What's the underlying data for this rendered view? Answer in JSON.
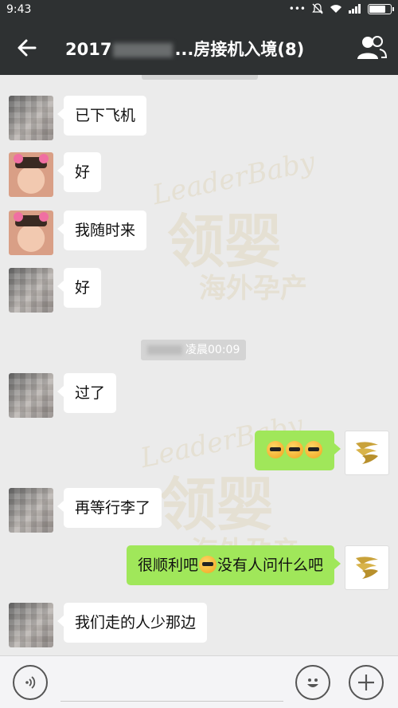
{
  "status": {
    "time": "9:43",
    "dots": "•••"
  },
  "header": {
    "title_prefix": "2017",
    "title_suffix": "...房接机入境(8)"
  },
  "chat": {
    "watermark_en": "LeaderBaby",
    "watermark_cn": "领婴",
    "watermark_sub": "海外孕产",
    "timestamp": "凌晨00:09",
    "messages": [
      {
        "side": "left",
        "avatar": "mosaic",
        "text": "已下飞机"
      },
      {
        "side": "left",
        "avatar": "cat",
        "text": "好"
      },
      {
        "side": "left",
        "avatar": "cat",
        "text": "我随时来"
      },
      {
        "side": "left",
        "avatar": "mosaic",
        "text": "好"
      },
      {
        "side": "left",
        "avatar": "mosaic",
        "text": "过了"
      },
      {
        "side": "right",
        "avatar": "logo",
        "text": ""
      },
      {
        "side": "left",
        "avatar": "mosaic",
        "text": "再等行李了"
      },
      {
        "side": "right",
        "avatar": "logo",
        "text_a": "很顺利吧",
        "text_b": "没有人问什么吧"
      },
      {
        "side": "left",
        "avatar": "mosaic",
        "text": "我们走的人少那边"
      }
    ]
  },
  "icons": {
    "back": "arrow-left-icon",
    "members": "group-icon",
    "voice": "voice-icon",
    "emoji": "smiley-icon",
    "plus": "plus-icon"
  },
  "colors": {
    "header_bg": "#2e3132",
    "chat_bg": "#ebebeb",
    "bubble_self": "#a0e75a",
    "bubble_other": "#ffffff"
  }
}
